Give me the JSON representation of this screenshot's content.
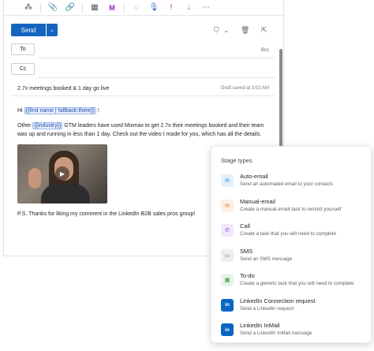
{
  "toolbar": {
    "icons": [
      "format-painter-icon",
      "attach-icon",
      "link-icon",
      "table-icon",
      "mixmax-icon",
      "chat-icon",
      "microphone-icon",
      "pin-icon",
      "arrow-down-icon",
      "more-icon"
    ]
  },
  "compose": {
    "send_label": "Send",
    "to_label": "To",
    "cc_label": "Cc",
    "bcc_label": "Bcc",
    "subject": "2.7x meetings booked & 1 day go live",
    "draft_status": "Draft saved at 3:02 AM",
    "greeting_prefix": "Hi ",
    "greeting_tag": "{{first name | fallback:there}}",
    "greeting_suffix": " !",
    "para_prefix": "Other ",
    "para_tag": "{{industry}}",
    "para_suffix": " GTM leaders have used Mixmax to get 2.7x their meetings booked and their team was up and running in less than 1 day. Check out the video I made for you, which has all the details.",
    "ps": "P.S. Thanks for liking my comment in the LinkedIn B2B sales pros group!"
  },
  "panel": {
    "title": "Stage types",
    "stages": [
      {
        "name": "Auto-email",
        "desc": "Send an automated email to your contacts",
        "icon": "mail-icon",
        "bg": "#e3f1fb",
        "fg": "#2b88d8"
      },
      {
        "name": "Manual-email",
        "desc": "Create a manual email task to remind yourself",
        "icon": "mail-icon",
        "bg": "#fdeee3",
        "fg": "#d9792b"
      },
      {
        "name": "Call",
        "desc": "Create a task that you will need to complete",
        "icon": "phone-icon",
        "bg": "#f3e8fb",
        "fg": "#8a3fc0"
      },
      {
        "name": "SMS",
        "desc": "Send an SMS message",
        "icon": "sms-icon",
        "bg": "#eeeeee",
        "fg": "#666666"
      },
      {
        "name": "To-do",
        "desc": "Create a generic task that you will need to complete",
        "icon": "calendar-icon",
        "bg": "#e6f5e8",
        "fg": "#2e8b3a"
      },
      {
        "name": "LinkedIn Connection request",
        "desc": "Send a LinkedIn request",
        "icon": "linkedin-icon",
        "bg": "#0a66c2",
        "fg": "#ffffff"
      },
      {
        "name": "LinkedIn InMail",
        "desc": "Send a LinkedIn InMail message",
        "icon": "linkedin-icon",
        "bg": "#0a66c2",
        "fg": "#ffffff"
      }
    ]
  }
}
